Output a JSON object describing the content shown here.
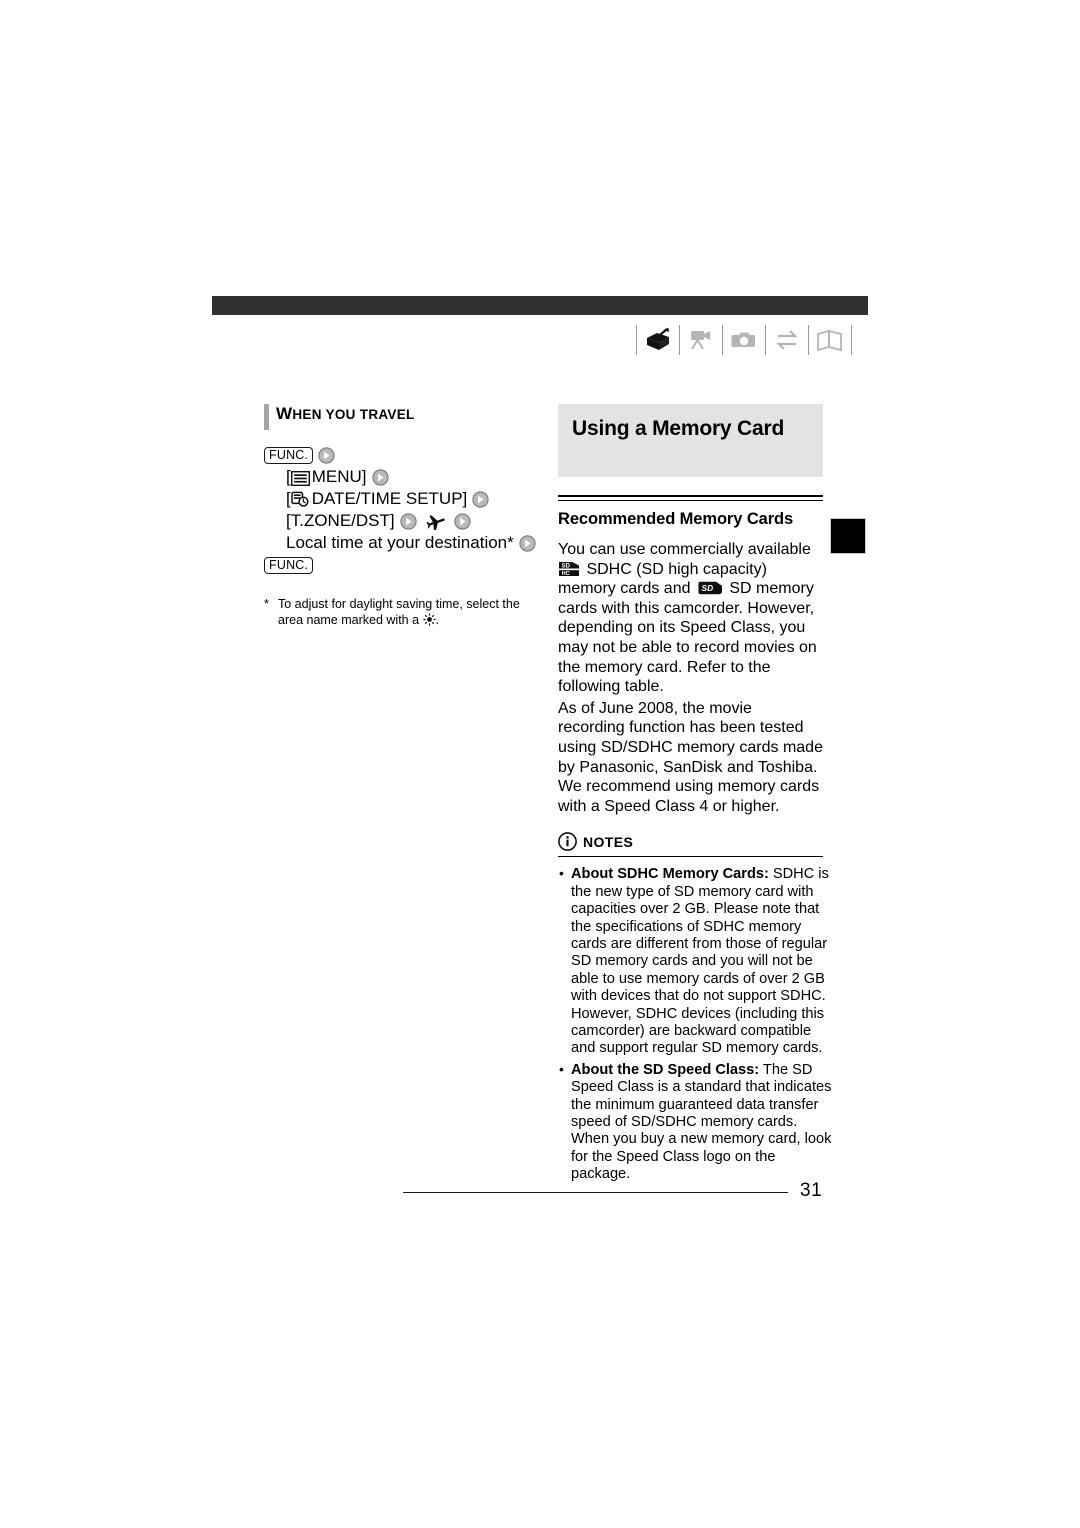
{
  "document": {
    "page_number": "31"
  },
  "mode_icons": [
    {
      "name": "camcorder-record-icon",
      "state": "active"
    },
    {
      "name": "movie-camera-icon",
      "state": "inactive"
    },
    {
      "name": "photo-camera-icon",
      "state": "inactive"
    },
    {
      "name": "transfer-arrows-icon",
      "state": "inactive"
    },
    {
      "name": "open-book-icon",
      "state": "inactive"
    }
  ],
  "left_column": {
    "section_heading": {
      "first_letters": "W",
      "rest": "HEN YOU TRAVEL",
      "full": "WHEN YOU TRAVEL"
    },
    "procedure": [
      {
        "id": "step-func-open",
        "button": "FUNC.",
        "trailing_arrow": true
      },
      {
        "id": "step-menu",
        "icon": "menu-list-icon",
        "label": "[ MENU]",
        "text_before": "[",
        "text_after": " MENU]",
        "trailing_arrow": true
      },
      {
        "id": "step-datetime-setup",
        "icon": "clock-calendar-icon",
        "text_before": "[",
        "text_after": " DATE/TIME SETUP]",
        "trailing_arrow": true
      },
      {
        "id": "step-tzone-dst",
        "label": "[T.ZONE/DST]",
        "icon": "airplane-icon",
        "trailing_arrow": true
      },
      {
        "id": "step-local-time",
        "label": "Local time at your destination*",
        "trailing_arrow": true
      },
      {
        "id": "step-func-close",
        "button": "FUNC.",
        "trailing_arrow": false
      }
    ],
    "footnote": {
      "marker": "*",
      "text_before": "To adjust for daylight saving time, select the area name marked with a ",
      "icon": "sun-dst-icon",
      "text_after": "."
    }
  },
  "right_column": {
    "title": "Using a Memory Card",
    "subheading": "Recommended Memory Cards",
    "paragraphs": [
      {
        "id": "paragraph-card-types",
        "segments": [
          {
            "type": "text",
            "value": "You can use commercially available "
          },
          {
            "type": "icon",
            "name": "sdhc-logo-icon"
          },
          {
            "type": "text",
            "value": " SDHC (SD high capacity) memory cards and "
          },
          {
            "type": "icon",
            "name": "sd-logo-icon"
          },
          {
            "type": "text",
            "value": " SD memory cards with this camcorder. However, depending on its Speed Class, you may not be able to record movies on the memory card. Refer to the following table."
          }
        ]
      },
      {
        "id": "paragraph-tested-cards",
        "text": "As of June 2008, the movie recording function has been tested using SD/SDHC memory cards made by Panasonic, SanDisk and Toshiba. We recommend using memory cards with a Speed Class 4 or higher."
      }
    ],
    "notes": {
      "icon": "info-circle-icon",
      "label": "NOTES",
      "items": [
        {
          "id": "note-about-sdhc",
          "bullet": "•",
          "strong": "About SDHC Memory Cards:",
          "text": " SDHC is the new type of SD memory card with capacities over 2 GB. Please note that the specifications of SDHC memory cards are different from those of regular SD memory cards and you will not be able to use memory cards of over 2 GB with devices that do not support SDHC. However, SDHC devices (including this camcorder) are backward compatible and support regular SD memory cards."
        },
        {
          "id": "note-about-speed-class",
          "bullet": "•",
          "strong": "About the SD Speed Class:",
          "text": " The SD Speed Class is a standard that indicates the minimum guaranteed data transfer speed of SD/SDHC memory cards. When you buy a new memory card, look for the Speed Class logo on the package."
        }
      ]
    }
  },
  "colors": {
    "header_bar": "#313131",
    "title_block_bg": "#e3e3e3",
    "accent_bar": "#a6a6a6",
    "edge_tab": "#000000",
    "inactive_icon": "#b5b5b5"
  }
}
